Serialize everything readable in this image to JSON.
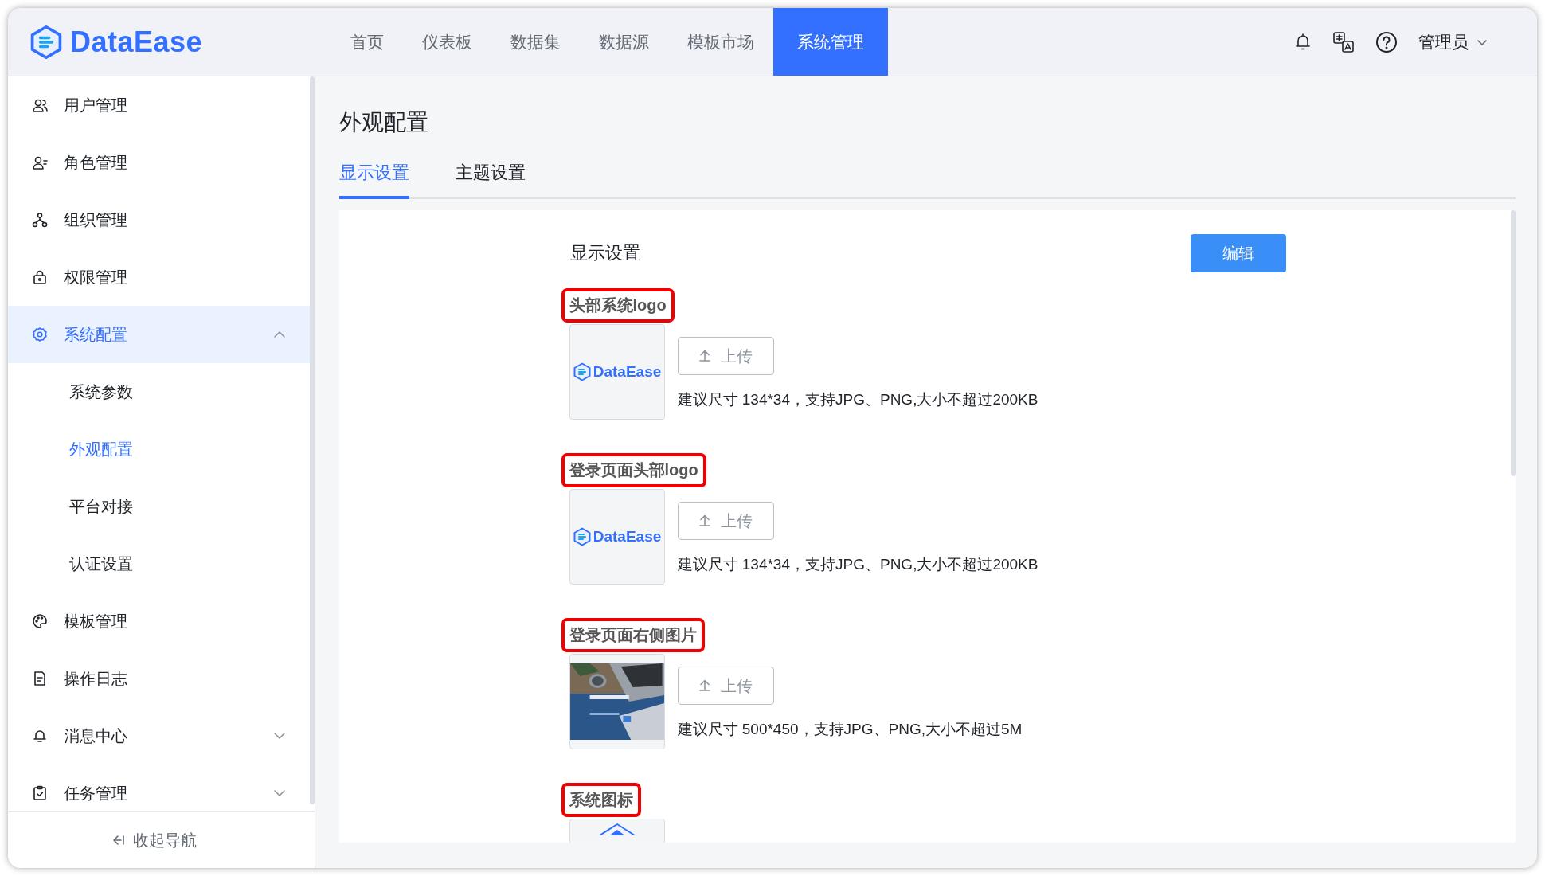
{
  "header": {
    "brand": "DataEase",
    "nav": [
      {
        "label": "首页",
        "selected": false
      },
      {
        "label": "仪表板",
        "selected": false
      },
      {
        "label": "数据集",
        "selected": false
      },
      {
        "label": "数据源",
        "selected": false
      },
      {
        "label": "模板市场",
        "selected": false
      },
      {
        "label": "系统管理",
        "selected": true
      }
    ],
    "user": "管理员"
  },
  "sidebar": {
    "items": [
      {
        "label": "用户管理",
        "selected": false
      },
      {
        "label": "角色管理",
        "selected": false
      },
      {
        "label": "组织管理",
        "selected": false
      },
      {
        "label": "权限管理",
        "selected": false
      },
      {
        "label": "系统配置",
        "selected": true,
        "expanded": true,
        "children": [
          {
            "label": "系统参数",
            "selected": false
          },
          {
            "label": "外观配置",
            "selected": true
          },
          {
            "label": "平台对接",
            "selected": false
          },
          {
            "label": "认证设置",
            "selected": false
          }
        ]
      },
      {
        "label": "模板管理",
        "selected": false
      },
      {
        "label": "操作日志",
        "selected": false
      },
      {
        "label": "消息中心",
        "selected": false,
        "expanded": false
      },
      {
        "label": "任务管理",
        "selected": false,
        "expanded": false
      }
    ],
    "collapse": "收起导航"
  },
  "page": {
    "title": "外观配置",
    "tabs": [
      {
        "label": "显示设置",
        "selected": true
      },
      {
        "label": "主题设置",
        "selected": false
      }
    ]
  },
  "form": {
    "title": "显示设置",
    "edit_button": "编辑",
    "fields": [
      {
        "label": "头部系统logo",
        "highlighted": true,
        "kind": "logo",
        "preview_text": "DataEase",
        "upload_button": "上传",
        "hint": "建议尺寸 134*34，支持JPG、PNG,大小不超过200KB"
      },
      {
        "label": "登录页面头部logo",
        "highlighted": true,
        "kind": "logo",
        "preview_text": "DataEase",
        "upload_button": "上传",
        "hint": "建议尺寸 134*34，支持JPG、PNG,大小不超过200KB"
      },
      {
        "label": "登录页面右侧图片",
        "highlighted": true,
        "kind": "picture",
        "upload_button": "上传",
        "hint": "建议尺寸 500*450，支持JPG、PNG,大小不超过5M"
      },
      {
        "label": "系统图标",
        "highlighted": true,
        "kind": "icon"
      }
    ]
  }
}
